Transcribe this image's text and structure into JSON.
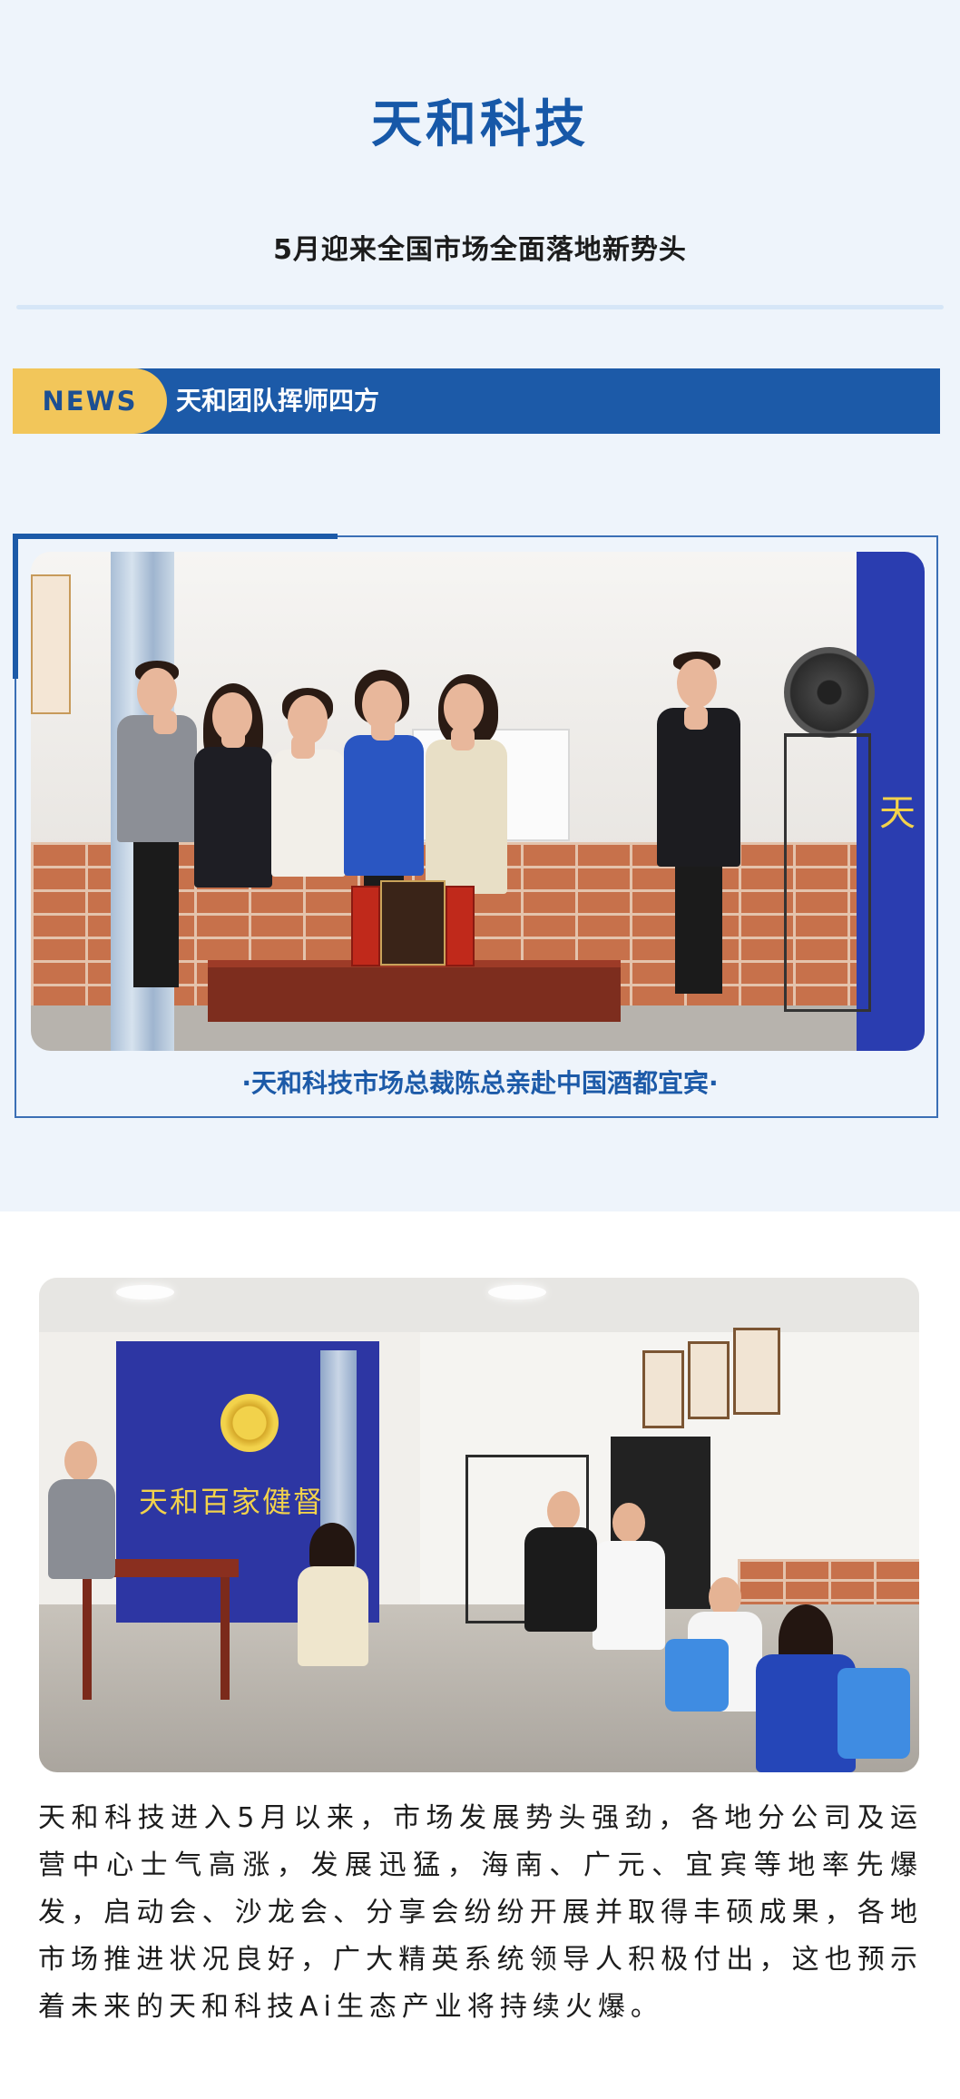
{
  "header": {
    "title": "天和科技",
    "subtitle": "5月迎来全国市场全面落地新势头"
  },
  "news_bar": {
    "tag": "NEWS",
    "text": "天和团队挥师四方"
  },
  "photo1": {
    "wall_char": "天",
    "caption": "·天和科技市场总裁陈总亲赴中国酒都宜宾·"
  },
  "photo2": {
    "wall_sign": "天和百家健督"
  },
  "article": {
    "paragraph": "天和科技进入5月以来，市场发展势头强劲，各地分公司及运营中心士气高涨，发展迅猛，海南、广元、宜宾等地率先爆发，启动会、沙龙会、分享会纷纷开展并取得丰硕成果，各地市场推进状况良好，广大精英系统领导人积极付出，这也预示着未来的天和科技Ai生态产业将持续火爆。"
  },
  "colors": {
    "brand_blue": "#1c5aa8",
    "title_blue": "#1758a8",
    "news_tag_yellow": "#f2c65a",
    "page_background": "#eef4fb"
  }
}
